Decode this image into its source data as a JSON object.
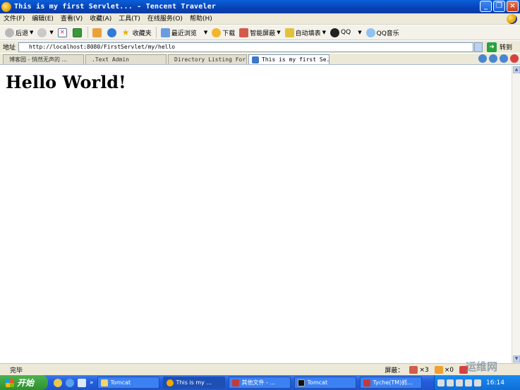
{
  "window": {
    "title": "This is my first Servlet... - Tencent Traveler",
    "buttons": {
      "minimize": "_",
      "maximize": "❐",
      "close": "×"
    }
  },
  "menu": [
    "文件(F)",
    "编辑(E)",
    "查看(V)",
    "收藏(A)",
    "工具(T)",
    "在线服务(O)",
    "帮助(H)"
  ],
  "toolbar": {
    "back": "后退",
    "favorites": "收藏夹",
    "recent": "最近浏览",
    "download": "下载",
    "smart_block": "智能屏蔽",
    "autofill": "自动填表",
    "qq": "QQ",
    "qq_music": "QQ音乐"
  },
  "address": {
    "label": "地址",
    "url": "http://localhost:8080/FirstServlet/my/hello",
    "go": "转到"
  },
  "tabs": [
    {
      "label": "博客园 - 悄然无声的 ...",
      "cjk": true,
      "active": false
    },
    {
      "label": ".Text Admin",
      "cjk": false,
      "active": false
    },
    {
      "label": "Directory Listing For /",
      "cjk": false,
      "active": false
    },
    {
      "label": "This is my first Se...",
      "cjk": false,
      "active": true
    }
  ],
  "page": {
    "heading": "Hello World!"
  },
  "status": {
    "text": "完毕",
    "block_label": "屏蔽：",
    "block_count": "×3",
    "popup_count": "×0"
  },
  "watermark": "运维网",
  "taskbar": {
    "start": "开始",
    "more": "»",
    "tasks": [
      {
        "label": "Tomcat",
        "icon": "folder",
        "active": false
      },
      {
        "label": "This is my ...",
        "icon": "ie",
        "active": true
      },
      {
        "label": "其他文件 - ...",
        "icon": "shot",
        "active": false
      },
      {
        "label": "Tomcat",
        "icon": "cmd",
        "active": false
      },
      {
        "label": "Tyche(TM)抓...",
        "icon": "shot",
        "active": false
      }
    ],
    "clock": "16:14"
  }
}
